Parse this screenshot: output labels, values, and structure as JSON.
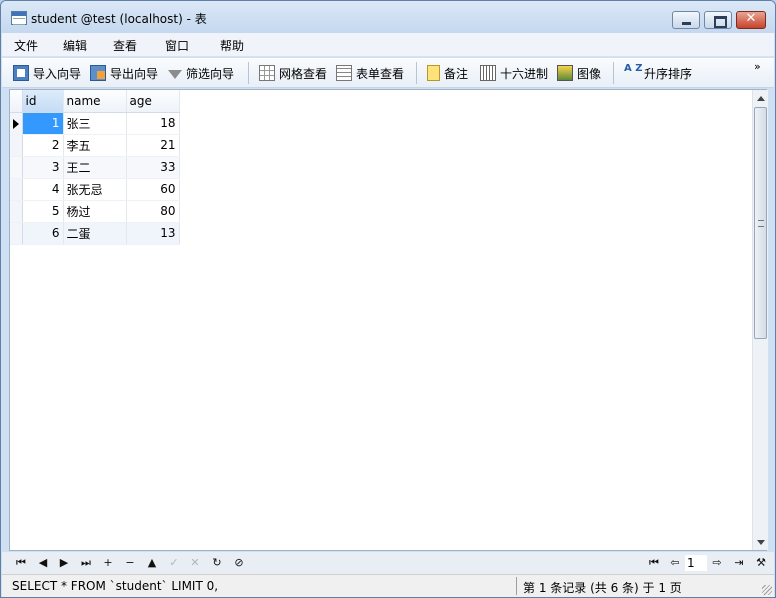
{
  "window": {
    "title": "student @test (localhost) - 表",
    "min_glyph": "",
    "close_glyph": "✕"
  },
  "menu": [
    "文件",
    "编辑",
    "查看",
    "窗口",
    "帮助"
  ],
  "toolbar": {
    "import_wizard": "导入向导",
    "export_wizard": "导出向导",
    "filter_wizard": "筛选向导",
    "grid_view": "网格查看",
    "form_view": "表单查看",
    "memo": "备注",
    "hex": "十六进制",
    "image": "图像",
    "sort_asc": "升序排序",
    "sort_icon_text": "A Z",
    "more": "»"
  },
  "table": {
    "columns": [
      "id",
      "name",
      "age"
    ],
    "rows": [
      {
        "id": "1",
        "name": "张三",
        "age": "18"
      },
      {
        "id": "2",
        "name": "李五",
        "age": "21"
      },
      {
        "id": "3",
        "name": "王二",
        "age": "33"
      },
      {
        "id": "4",
        "name": "张无忌",
        "age": "60"
      },
      {
        "id": "5",
        "name": "杨过",
        "age": "80"
      },
      {
        "id": "6",
        "name": "二蛋",
        "age": "13"
      }
    ]
  },
  "navbar": {
    "first": "⏮",
    "prev": "◀",
    "next": "▶",
    "last": "⏭",
    "add": "+",
    "delete": "−",
    "up": "▲",
    "apply": "✓",
    "cancel": "✕",
    "refresh": "↻",
    "stop": "⊘",
    "page_first": "⏮",
    "page_prev": "⇦",
    "page_number": "1",
    "page_next": "⇨",
    "page_last": "⇥",
    "tools": "⚒"
  },
  "status": {
    "sql": "SELECT * FROM `student` LIMIT 0,",
    "record_info": "第 1 条记录 (共 6 条) 于 1 页"
  }
}
